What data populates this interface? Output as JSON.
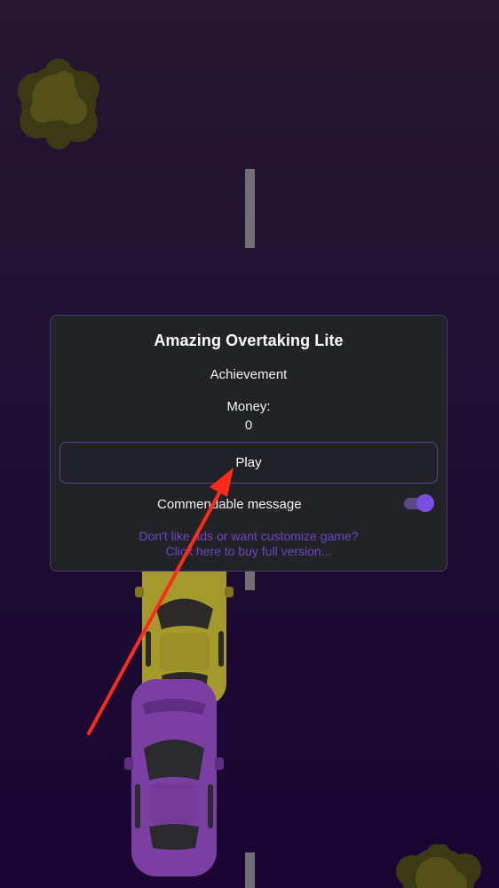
{
  "dialog": {
    "title": "Amazing Overtaking Lite",
    "achievement_label": "Achievement",
    "money_label": "Money:",
    "money_value": "0",
    "play_label": "Play",
    "toggle_label": "Commendable message",
    "toggle_on": true,
    "upsell_line1": "Don't like ads or want customize game?",
    "upsell_line2": "Click here to buy full version..."
  },
  "scene": {
    "player_car_color": "#7b3fa3",
    "traffic_car_color": "#a49a2c",
    "accent_color": "#7a4ee0",
    "annotation_arrow_color": "#ff2a1a"
  }
}
